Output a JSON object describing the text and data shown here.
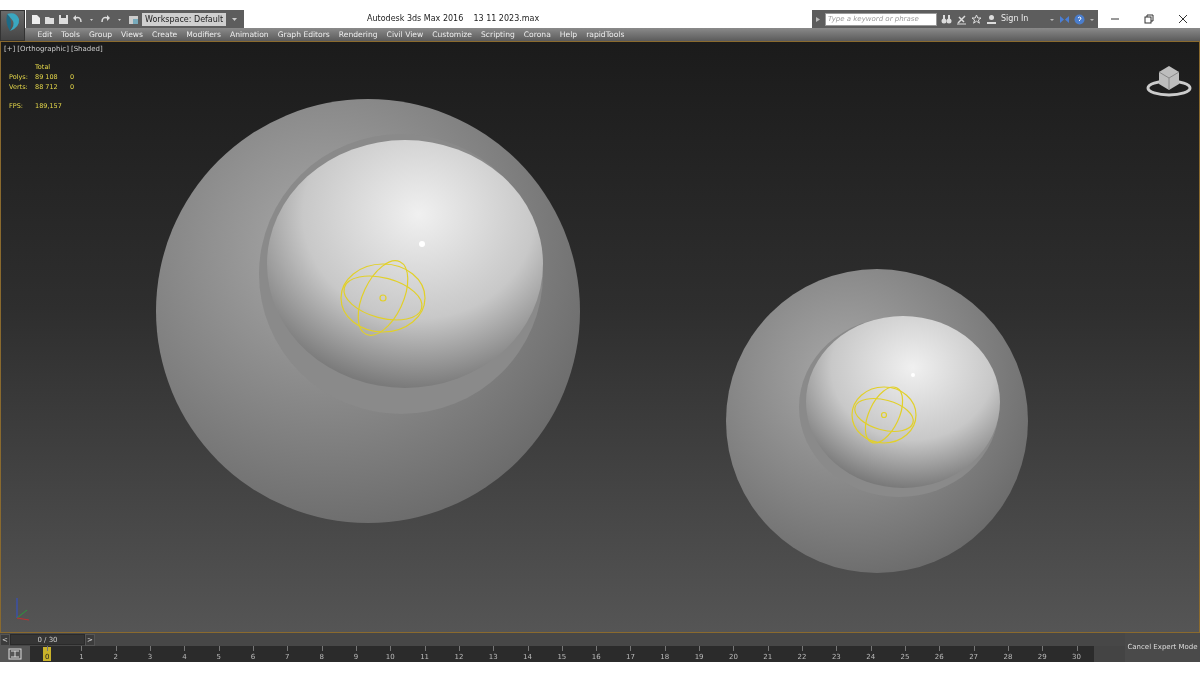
{
  "window": {
    "title": "Autodesk 3ds Max 2016    13 11 2023.max"
  },
  "quick_access": {
    "workspace": "Workspace: Default"
  },
  "infocenter": {
    "placeholder": "Type a keyword or phrase",
    "sign_in": "Sign In"
  },
  "menu": [
    "Edit",
    "Tools",
    "Group",
    "Views",
    "Create",
    "Modifiers",
    "Animation",
    "Graph Editors",
    "Rendering",
    "Civil View",
    "Customize",
    "Scripting",
    "Corona",
    "Help",
    "rapidTools"
  ],
  "viewport": {
    "labels": [
      "[+]",
      "[Orthographic]",
      "[Shaded]"
    ],
    "stats": {
      "header": "Total",
      "rows": [
        {
          "label": "Polys:",
          "total": "89 108",
          "selected": "0"
        },
        {
          "label": "Verts:",
          "total": "88 712",
          "selected": "0"
        }
      ],
      "fps_label": "FPS:",
      "fps": "189,157"
    }
  },
  "time_slider": {
    "prev": "<",
    "label": "0 / 30",
    "next": ">",
    "level": 0
  },
  "trackbar": {
    "frames": [
      "0",
      "1",
      "2",
      "3",
      "4",
      "5",
      "6",
      "7",
      "8",
      "9",
      "10",
      "11",
      "12",
      "13",
      "14",
      "15",
      "16",
      "17",
      "18",
      "19",
      "20",
      "21",
      "22",
      "23",
      "24",
      "25",
      "26",
      "27",
      "28",
      "29",
      "30"
    ]
  },
  "status_bar": {
    "expert_mode": "Cancel Expert Mode"
  }
}
